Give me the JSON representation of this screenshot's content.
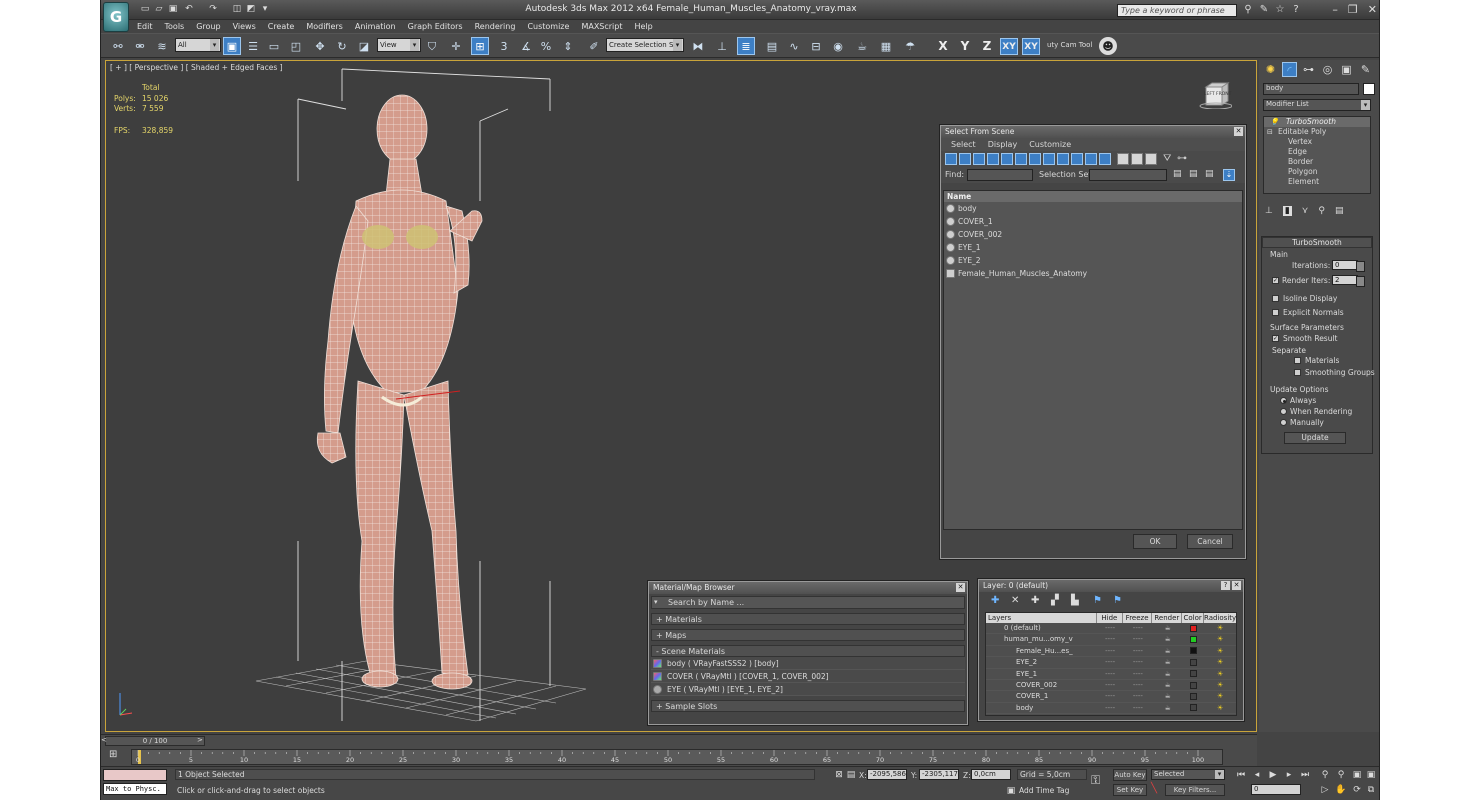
{
  "app": {
    "logo_glyph": "G",
    "title": "Autodesk 3ds Max  2012 x64      Female_Human_Muscles_Anatomy_vray.max",
    "search_placeholder": "Type a keyword or phrase",
    "quick_access": [
      "new-icon",
      "open-icon",
      "save-icon",
      "undo-icon",
      "redo-icon",
      "hold-icon",
      "fetch-icon",
      "project-icon"
    ],
    "window_controls": [
      "–",
      "❐",
      "✕"
    ]
  },
  "menu": [
    "Edit",
    "Tools",
    "Group",
    "Views",
    "Create",
    "Modifiers",
    "Animation",
    "Graph Editors",
    "Rendering",
    "Customize",
    "MAXScript",
    "Help"
  ],
  "toolbar": {
    "selection_filter": "All",
    "ref_coord": "View",
    "named_selection": "Create Selection Se",
    "axes": [
      "X",
      "Y",
      "Z",
      "XY",
      "XY"
    ],
    "cam_tool_label": "uty Cam Tool",
    "snap_labels": [
      "3",
      "%"
    ]
  },
  "viewport": {
    "label": "[ + ] [ Perspective ] [ Shaded + Edged Faces ]",
    "stats": {
      "total_label": "Total",
      "polys_label": "Polys:",
      "polys": "15 026",
      "verts_label": "Verts:",
      "verts": "7 559",
      "fps_label": "FPS:",
      "fps": "328,859"
    },
    "viewcube_label": "LEFT  FRONT",
    "accent_color": "#c9a43a"
  },
  "select_from_scene": {
    "title": "Select From Scene",
    "menus": [
      "Select",
      "Display",
      "Customize"
    ],
    "find_label": "Find:",
    "selection_set_label": "Selection Set:",
    "column_name": "Name",
    "items": [
      "body",
      "COVER_1",
      "COVER_002",
      "EYE_1",
      "EYE_2",
      "Female_Human_Muscles_Anatomy"
    ],
    "ok": "OK",
    "cancel": "Cancel"
  },
  "material_browser": {
    "title": "Material/Map Browser",
    "search_placeholder": "Search by Name ...",
    "sections": [
      "+ Materials",
      "+ Maps",
      "- Scene Materials"
    ],
    "scene_materials": [
      "body  ( VRayFastSSS2 ) [body]",
      "COVER  ( VRayMtl ) [COVER_1, COVER_002]",
      "EYE  ( VRayMtl ) [EYE_1, EYE_2]"
    ],
    "footer_section": "+ Sample Slots"
  },
  "layer_dialog": {
    "title": "Layer: 0 (default)",
    "columns": [
      "Layers",
      "Hide",
      "Freeze",
      "Render",
      "Color",
      "Radiosity"
    ],
    "rows": [
      {
        "name": "0 (default)",
        "color": "#e02020"
      },
      {
        "name": "human_mu...omy_v",
        "color": "#22cc22"
      },
      {
        "name": "Female_Hu...es_",
        "color": "#111111"
      },
      {
        "name": "EYE_2",
        "color": "#444444"
      },
      {
        "name": "EYE_1",
        "color": "#444444"
      },
      {
        "name": "COVER_002",
        "color": "#444444"
      },
      {
        "name": "COVER_1",
        "color": "#444444"
      },
      {
        "name": "body",
        "color": "#444444"
      }
    ],
    "help": "?",
    "close": "✕"
  },
  "command_panel": {
    "object_name": "body",
    "modifier_list_label": "Modifier List",
    "stack": [
      "TurboSmooth",
      "Editable Poly",
      "Vertex",
      "Edge",
      "Border",
      "Polygon",
      "Element"
    ],
    "turbosmooth": {
      "title": "TurboSmooth",
      "main_label": "Main",
      "iterations_label": "Iterations:",
      "iterations": "0",
      "render_iters_label": "Render Iters:",
      "render_iters": "2",
      "isoline_label": "Isoline Display",
      "explicit_normals_label": "Explicit Normals",
      "surface_params_label": "Surface Parameters",
      "smooth_result_label": "Smooth Result",
      "separate_label": "Separate",
      "materials_label": "Materials",
      "smoothing_groups_label": "Smoothing Groups",
      "update_options_label": "Update Options",
      "always_label": "Always",
      "when_rendering_label": "When Rendering",
      "manually_label": "Manually",
      "update_button": "Update"
    }
  },
  "timeline": {
    "frame_counter": "0 / 100",
    "ticks": [
      "0",
      "5",
      "10",
      "15",
      "20",
      "25",
      "30",
      "35",
      "40",
      "45",
      "50",
      "55",
      "60",
      "65",
      "70",
      "75",
      "80",
      "85",
      "90",
      "95",
      "100"
    ]
  },
  "status": {
    "maxscript_label": "Max to Physc.",
    "objects_selected": "1 Object Selected",
    "prompt": "Click or click-and-drag to select objects",
    "x_label": "X:",
    "x_value": "-2095,586",
    "y_label": "Y:",
    "y_value": "-2305,117",
    "z_label": "Z:",
    "z_value": "0,0cm",
    "grid": "Grid = 5,0cm",
    "add_time_tag": "Add Time Tag",
    "auto_key": "Auto Key",
    "set_key": "Set Key",
    "key_mode": "Selected",
    "key_filters": "Key Filters...",
    "current_frame": "0"
  }
}
